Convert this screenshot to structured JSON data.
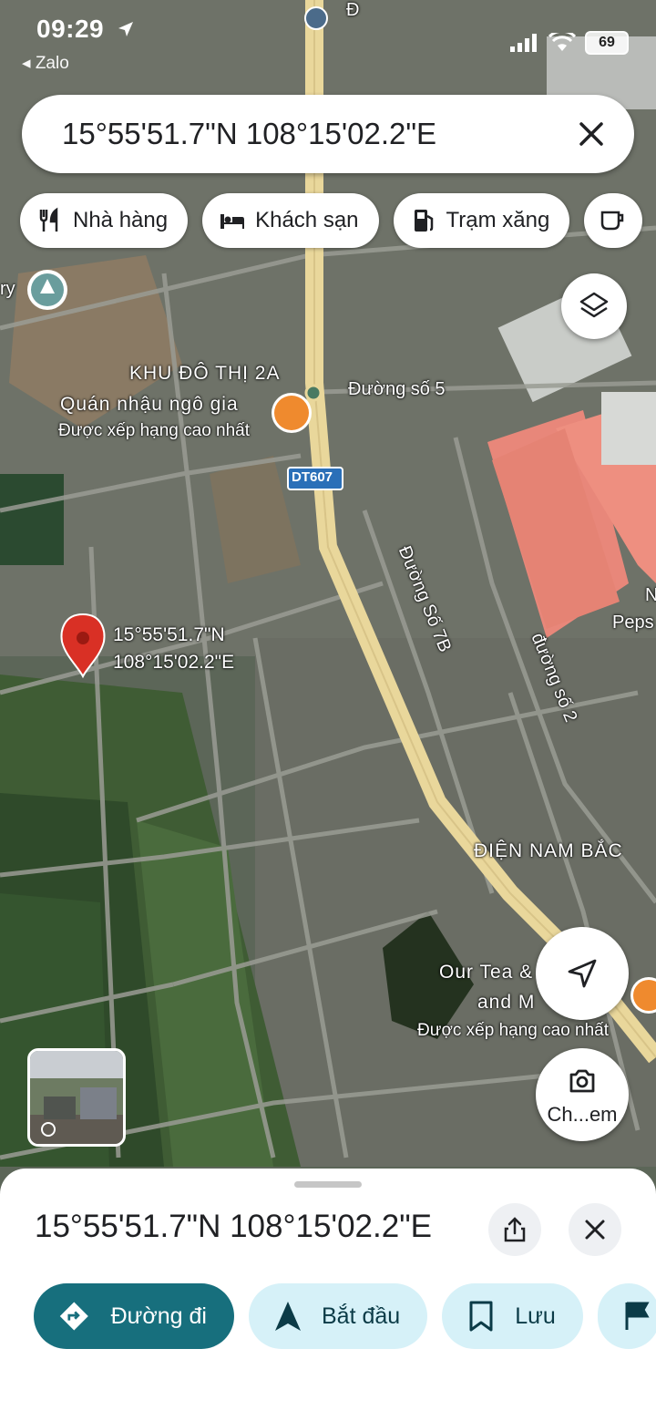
{
  "status_bar": {
    "time": "09:29",
    "back_app": "Zalo",
    "battery": "69"
  },
  "search": {
    "query": "15°55'51.7\"N 108°15'02.2\"E"
  },
  "chips": [
    {
      "label": "Nhà hàng",
      "icon": "restaurant-icon"
    },
    {
      "label": "Khách sạn",
      "icon": "hotel-icon"
    },
    {
      "label": "Trạm xăng",
      "icon": "gas-station-icon"
    }
  ],
  "map": {
    "labels": {
      "area_2a": "KHU ĐÔ THỊ 2A",
      "restaurant_name": "Quán nhậu ngô gia",
      "restaurant_rating": "Được xếp hạng cao nhất",
      "road_5": "Đường số 5",
      "road_dt607": "DT607",
      "road_7b": "Đường Số 7B",
      "road_2": "đường số 2",
      "dien_nam_bac": "ĐIỆN NAM BẮC",
      "cafe_name_1": "Our Tea &",
      "cafe_name_2": "and M",
      "cafe_rating": "Được xếp hạng cao nhất",
      "peps": "Peps",
      "edge_ry": "ry",
      "edge_d": "Đ",
      "edge_n": "N"
    },
    "pin": {
      "lat": "15°55'51.7\"N",
      "lng": "108°15'02.2\"E"
    },
    "camera_label": "Ch...em"
  },
  "sheet": {
    "title": "15°55'51.7\"N 108°15'02.2\"E",
    "actions": [
      {
        "label": "Đường đi",
        "icon": "directions-icon"
      },
      {
        "label": "Bắt đầu",
        "icon": "navigation-arrow-icon"
      },
      {
        "label": "Lưu",
        "icon": "bookmark-icon"
      }
    ]
  },
  "colors": {
    "teal": "#176f7d",
    "light_teal": "#d6f1f8",
    "road_yellow": "#e9d79b",
    "pin_red": "#d93025"
  }
}
